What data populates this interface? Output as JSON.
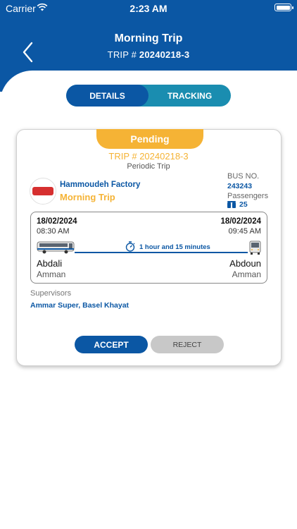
{
  "status_bar": {
    "carrier": "Carrier",
    "time": "2:23 AM"
  },
  "header": {
    "title": "Morning Trip",
    "trip_prefix": "TRIP # ",
    "trip_number": "20240218-3"
  },
  "tabs": [
    {
      "label": "DETAILS",
      "active": true
    },
    {
      "label": "TRACKING",
      "active": false
    }
  ],
  "card": {
    "status": "Pending",
    "trip_label": "TRIP # 20240218-3",
    "trip_type": "Periodic Trip",
    "company": "Hammoudeh Factory",
    "trip_name": "Morning Trip",
    "bus_label": "BUS NO.",
    "bus_number": "243243",
    "passengers_label": "Passengers",
    "passengers_count": "25",
    "route": {
      "departure_date": "18/02/2024",
      "departure_time": "08:30 AM",
      "arrival_date": "18/02/2024",
      "arrival_time": "09:45 AM",
      "duration": "1 hour and 15 minutes",
      "from_stop": "Abdali",
      "from_city": "Amman",
      "to_stop": "Abdoun",
      "to_city": "Amman"
    },
    "supervisors_label": "Supervisors",
    "supervisors": "Ammar Super, Basel Khayat",
    "accept_label": "ACCEPT",
    "reject_label": "REJECT"
  },
  "colors": {
    "primary": "#0b57a4",
    "accent": "#f5b335",
    "tracking": "#1a8db0",
    "reject": "#c8c8c8"
  }
}
